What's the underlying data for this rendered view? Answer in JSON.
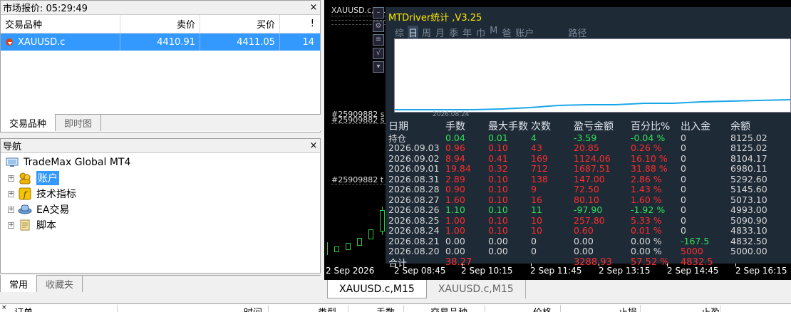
{
  "market_watch": {
    "title": "市场报价: 05:29:49",
    "close": "×",
    "columns": [
      "交易品种",
      "卖价",
      "买价",
      "!"
    ],
    "rows": [
      {
        "symbol": "XAUUSD.c",
        "bid": "4410.91",
        "ask": "4411.05",
        "spread": "14"
      }
    ],
    "tabs": [
      "交易品种",
      "即时图"
    ]
  },
  "navigator": {
    "title": "导航",
    "close": "×",
    "root": "TradeMax Global MT4",
    "items": [
      "账户",
      "技术指标",
      "EA交易",
      "脚本"
    ],
    "tabs": [
      "常用",
      "收藏夹"
    ]
  },
  "chart": {
    "symbol_label": "XAUUSD.c,M15",
    "order_labels": [
      "#25909882 s",
      "#25909882 s",
      "#25909882 t"
    ],
    "x_labels": [
      "2 Sep 2026",
      "2 Sep 08:45",
      "2 Sep 10:15",
      "2 Sep 11:45",
      "2 Sep 13:15",
      "2 Sep 14:45",
      "2 Sep 16:15"
    ],
    "tabs": [
      "XAUUSD.c,M15",
      "XAUUSD.c,M15"
    ]
  },
  "mtdriver": {
    "title": "MTDriver统计 ,V3.25",
    "tabs": [
      "综",
      "日",
      "周",
      "月",
      "季",
      "年",
      "巾",
      "M",
      "爸",
      "账户",
      "路径"
    ],
    "graph_date": "2026.08.24",
    "headers": [
      "日期",
      "手数",
      "最大手数",
      "次数",
      "盈亏金额",
      "百分比%",
      "出入金",
      "余额"
    ],
    "rows": [
      {
        "date": "持仓",
        "lots": "0.04",
        "max": "0.01",
        "count": "4",
        "pnl": "-3.59",
        "pct": "-0.04 %",
        "io": "0",
        "bal": "8125.02",
        "color": "green"
      },
      {
        "date": "2026.09.03",
        "lots": "0.96",
        "max": "0.10",
        "count": "43",
        "pnl": "20.85",
        "pct": "0.26 %",
        "io": "0",
        "bal": "8125.02",
        "color": "red"
      },
      {
        "date": "2026.09.02",
        "lots": "8.94",
        "max": "0.41",
        "count": "169",
        "pnl": "1124.06",
        "pct": "16.10 %",
        "io": "0",
        "bal": "8104.17",
        "color": "red"
      },
      {
        "date": "2026.09.01",
        "lots": "19.84",
        "max": "0.32",
        "count": "712",
        "pnl": "1687.51",
        "pct": "31.88 %",
        "io": "0",
        "bal": "6980.11",
        "color": "red"
      },
      {
        "date": "2026.08.31",
        "lots": "2.89",
        "max": "0.10",
        "count": "138",
        "pnl": "147.00",
        "pct": "2.86 %",
        "io": "0",
        "bal": "5292.60",
        "color": "red"
      },
      {
        "date": "2026.08.28",
        "lots": "0.90",
        "max": "0.10",
        "count": "9",
        "pnl": "72.50",
        "pct": "1.43 %",
        "io": "0",
        "bal": "5145.60",
        "color": "red"
      },
      {
        "date": "2026.08.27",
        "lots": "1.60",
        "max": "0.10",
        "count": "16",
        "pnl": "80.10",
        "pct": "1.60 %",
        "io": "0",
        "bal": "5073.10",
        "color": "red"
      },
      {
        "date": "2026.08.26",
        "lots": "1.10",
        "max": "0.10",
        "count": "11",
        "pnl": "-97.90",
        "pct": "-1.92 %",
        "io": "0",
        "bal": "4993.00",
        "color": "green"
      },
      {
        "date": "2026.08.25",
        "lots": "1.00",
        "max": "0.10",
        "count": "10",
        "pnl": "257.80",
        "pct": "5.33 %",
        "io": "0",
        "bal": "5090.90",
        "color": "red"
      },
      {
        "date": "2026.08.24",
        "lots": "1.00",
        "max": "0.10",
        "count": "10",
        "pnl": "0.60",
        "pct": "0.01 %",
        "io": "0",
        "bal": "4833.10",
        "color": "red"
      },
      {
        "date": "2026.08.21",
        "lots": "0.00",
        "max": "0.00",
        "count": "0",
        "pnl": "0.00",
        "pct": "0.00 %",
        "io": "-167.5",
        "bal": "4832.50",
        "color": "grey",
        "io_color": "green"
      },
      {
        "date": "2026.08.20",
        "lots": "0.00",
        "max": "0.00",
        "count": "0",
        "pnl": "0.00",
        "pct": "0.00 %",
        "io": "5000",
        "bal": "5000.00",
        "color": "grey",
        "io_color": "red"
      }
    ],
    "sum": {
      "date": "合计",
      "lots": "38.27",
      "pnl": "3288.93",
      "pct": "57.52 %",
      "io": "4832.5"
    }
  },
  "terminal": {
    "columns": [
      "订单",
      "时间",
      "类型",
      "手数",
      "交易品种",
      "价格",
      "止损",
      "止盈"
    ]
  },
  "colors": {
    "accent": "#3399ff",
    "profit": "#ff2d2d",
    "loss": "#33e05a",
    "title": "#ffea00"
  }
}
